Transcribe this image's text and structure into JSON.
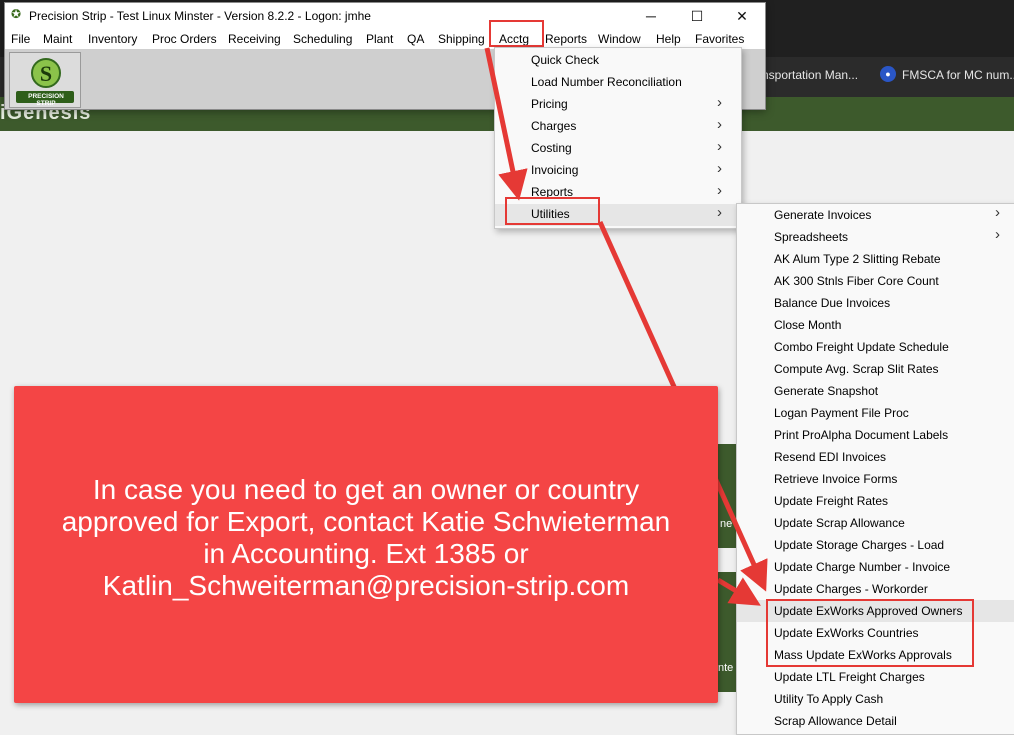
{
  "background": {
    "banner_text": "iGenesis",
    "bookmarks": [
      "nsportation Man...",
      "FMSCA for MC num..."
    ],
    "tiles": [
      ":",
      "ne",
      "nte"
    ]
  },
  "window": {
    "title": "Precision Strip - Test Linux Minster - Version 8.2.2 - Logon: jmhe",
    "controls": {
      "minimize": "─",
      "maximize": "☐",
      "close": "✕"
    },
    "menu": [
      "File",
      "Maint",
      "Inventory",
      "Proc Orders",
      "Receiving",
      "Scheduling",
      "Plant",
      "QA",
      "Shipping",
      "Acctg",
      "Reports",
      "Window",
      "Help",
      "Favorites"
    ],
    "logo_text": "PRECISION STRIP"
  },
  "acctg_menu": {
    "items": [
      {
        "label": "Quick Check",
        "submenu": false
      },
      {
        "label": "Load Number Reconciliation",
        "submenu": false
      },
      {
        "label": "Pricing",
        "submenu": true
      },
      {
        "label": "Charges",
        "submenu": true
      },
      {
        "label": "Costing",
        "submenu": true
      },
      {
        "label": "Invoicing",
        "submenu": true
      },
      {
        "label": "Reports",
        "submenu": true
      },
      {
        "label": "Utilities",
        "submenu": true
      }
    ]
  },
  "utilities_menu": {
    "items": [
      {
        "label": "Generate Invoices",
        "submenu": true
      },
      {
        "label": "Spreadsheets",
        "submenu": true
      },
      {
        "label": "AK Alum Type 2 Slitting Rebate"
      },
      {
        "label": "AK 300 Stnls Fiber Core Count"
      },
      {
        "label": "Balance Due Invoices"
      },
      {
        "label": "Close Month"
      },
      {
        "label": "Combo Freight Update Schedule"
      },
      {
        "label": "Compute Avg. Scrap Slit Rates"
      },
      {
        "label": "Generate Snapshot"
      },
      {
        "label": "Logan Payment File Proc"
      },
      {
        "label": "Print ProAlpha Document Labels"
      },
      {
        "label": "Resend EDI Invoices"
      },
      {
        "label": "Retrieve Invoice Forms"
      },
      {
        "label": "Update Freight Rates"
      },
      {
        "label": "Update Scrap Allowance"
      },
      {
        "label": "Update Storage Charges - Load"
      },
      {
        "label": "Update Charge Number - Invoice"
      },
      {
        "label": "Update Charges - Workorder"
      },
      {
        "label": "Update ExWorks Approved Owners"
      },
      {
        "label": "Update ExWorks Countries"
      },
      {
        "label": "Mass Update ExWorks Approvals"
      },
      {
        "label": "Update LTL Freight Charges"
      },
      {
        "label": "Utility To Apply Cash"
      },
      {
        "label": "Scrap Allowance Detail"
      }
    ]
  },
  "callout": {
    "text": "In case you need to get an owner or country approved for Export, contact Katie Schwieterman in Accounting. Ext 1385 or Katlin_Schweiterman@precision-strip.com"
  },
  "colors": {
    "annotation_red": "#e53935",
    "callout_bg": "#f44545",
    "banner_green": "#3d5a2c"
  }
}
